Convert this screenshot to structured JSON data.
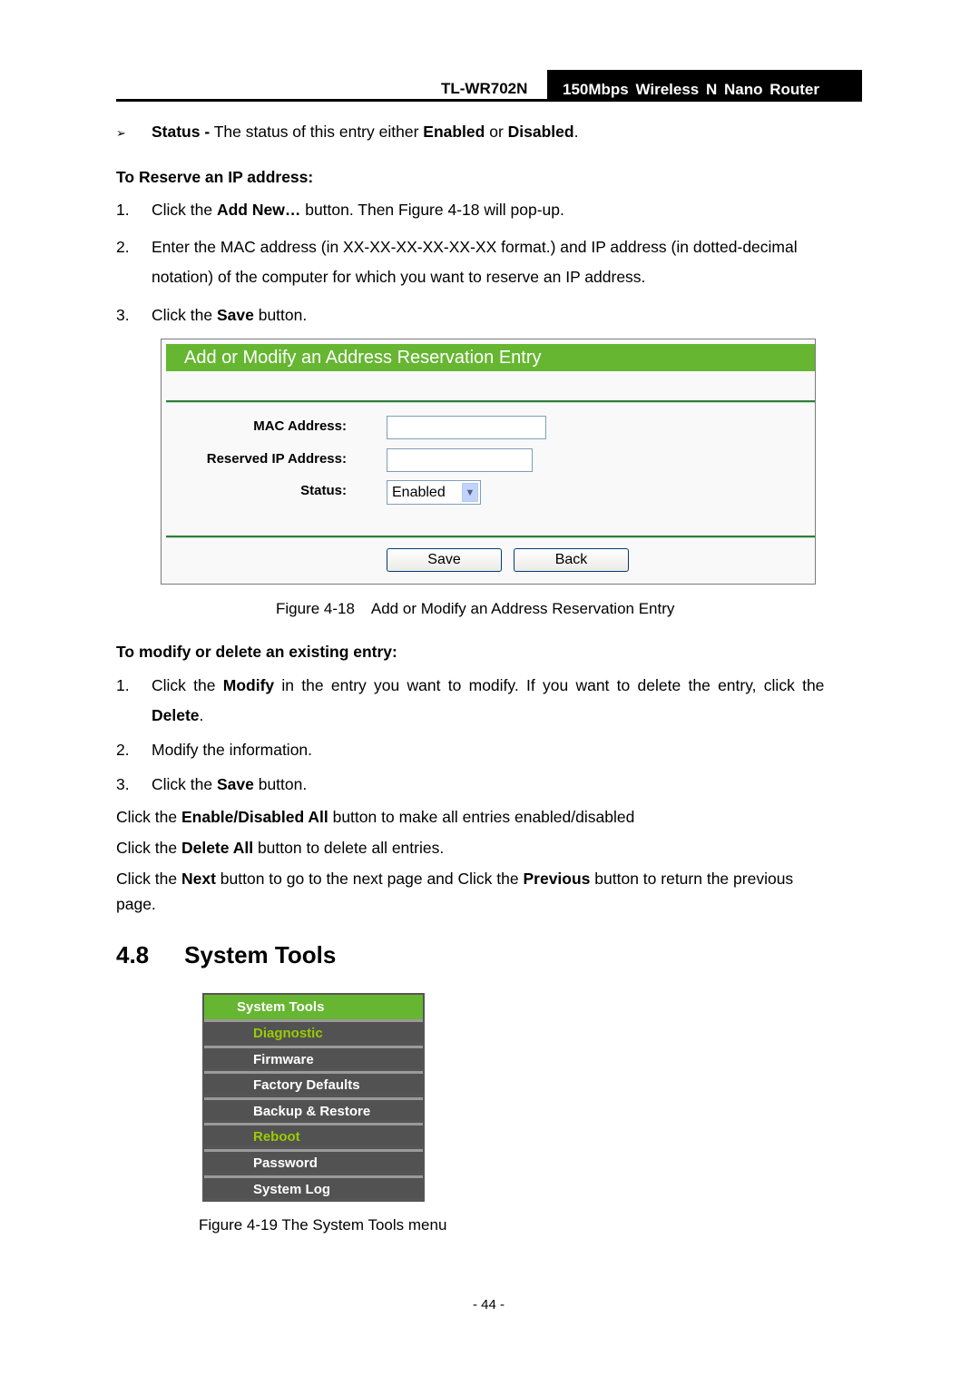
{
  "header": {
    "model": "TL-WR702N",
    "product": "150Mbps Wireless N Nano Router"
  },
  "status_bullet": {
    "marker": "➢",
    "term": "Status -",
    "text_1": " The status of this entry either ",
    "enabled": "Enabled",
    "text_2": " or ",
    "disabled": "Disabled",
    "text_3": "."
  },
  "reserve_section": {
    "heading": "To Reserve an IP address:",
    "steps": [
      {
        "num": "1.",
        "pre": "Click the ",
        "bold": "Add New…",
        "post": " button. Then Figure 4-18 will pop-up."
      },
      {
        "num": "2.",
        "line1": "Enter the MAC address (in XX-XX-XX-XX-XX-XX format.) and IP address (in dotted-decimal",
        "line2": "notation) of the computer for which you want to reserve an IP address."
      },
      {
        "num": "3.",
        "pre": "Click the ",
        "bold": "Save",
        "post": " button."
      }
    ]
  },
  "figure_18": {
    "panel_title": "Add or Modify an Address Reservation Entry",
    "fields": {
      "mac_label": "MAC Address:",
      "mac_value": "",
      "ip_label": "Reserved IP Address:",
      "ip_value": "",
      "status_label": "Status:",
      "status_value": "Enabled"
    },
    "buttons": {
      "save": "Save",
      "back": "Back"
    },
    "caption": "Figure 4-18    Add or Modify an Address Reservation Entry"
  },
  "modify_section": {
    "heading": "To modify or delete an existing entry:",
    "steps": [
      {
        "num": "1.",
        "pre": "Click the ",
        "bold": "Modify",
        "post": " in the entry you want to modify. If you want to delete the entry, click the",
        "line2_bold": "Delete",
        "line2_post": "."
      },
      {
        "num": "2.",
        "text": "Modify the information."
      },
      {
        "num": "3.",
        "pre": "Click the ",
        "bold": "Save",
        "post": " button."
      }
    ]
  },
  "paragraphs": [
    {
      "pre": "Click the ",
      "bold": "Enable/Disabled All",
      "post": " button to make all entries enabled/disabled"
    },
    {
      "pre": "Click the ",
      "bold": "Delete All",
      "post": " button to delete all entries."
    },
    {
      "pre": "Click the ",
      "bold": "Next",
      "mid": " button to go to the next page and Click the ",
      "bold2": "Previous",
      "post": " button to return the previous",
      "line2": "page."
    }
  ],
  "section": {
    "number": "4.8",
    "title": "System Tools"
  },
  "figure_19": {
    "menu_header": "System Tools",
    "items": [
      {
        "label": "Diagnostic",
        "active": true
      },
      {
        "label": "Firmware",
        "active": false
      },
      {
        "label": "Factory Defaults",
        "active": false
      },
      {
        "label": "Backup & Restore",
        "active": false
      },
      {
        "label": "Reboot",
        "active": true
      },
      {
        "label": "Password",
        "active": false
      },
      {
        "label": "System Log",
        "active": false
      }
    ],
    "caption": "Figure 4-19 The System Tools menu"
  },
  "footer": {
    "page_number": "- 44 -"
  },
  "colors": {
    "accent_green": "#66b631",
    "menu_bg": "#525252",
    "menu_active_text": "#99cc00"
  }
}
